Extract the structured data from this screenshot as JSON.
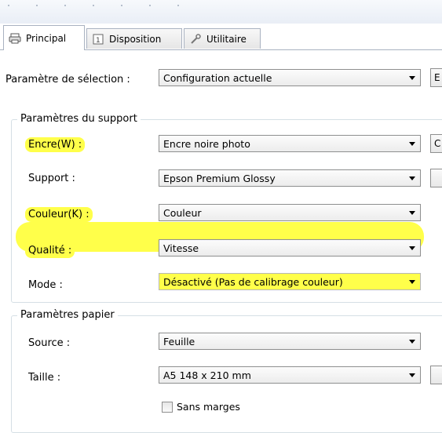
{
  "tabs": [
    {
      "label": "Principal",
      "icon": "printer-icon",
      "active": true
    },
    {
      "label": "Disposition",
      "icon": "page-layout-icon",
      "active": false
    },
    {
      "label": "Utilitaire",
      "icon": "wrench-icon",
      "active": false
    }
  ],
  "selection": {
    "label": "Paramètre de sélection :",
    "value": "Configuration actuelle",
    "button_partial": "E"
  },
  "support_group": {
    "title": "Paramètres du support",
    "rows": [
      {
        "label": "Encre(W) :",
        "value": "Encre noire photo",
        "highlighted": true,
        "button_partial": "C"
      },
      {
        "label": "Support :",
        "value": "Epson Premium Glossy",
        "highlighted": false,
        "button_partial": ""
      },
      {
        "label": "Couleur(K) :",
        "value": "Couleur",
        "highlighted": true
      },
      {
        "label": "Qualité :",
        "value": "Vitesse",
        "highlighted": true
      },
      {
        "label": "Mode :",
        "value": "Désactivé (Pas de calibrage couleur)",
        "highlighted": true
      }
    ]
  },
  "paper_group": {
    "title": "Paramètres papier",
    "rows": [
      {
        "label": "Source :",
        "value": "Feuille"
      },
      {
        "label": "Taille :",
        "value": "A5 148 x 210 mm",
        "button_partial": ""
      }
    ],
    "borderless_label": "Sans marges",
    "borderless_checked": false
  },
  "colors": {
    "highlight": "#ffff4a",
    "tab_border": "#a9b2c1"
  }
}
